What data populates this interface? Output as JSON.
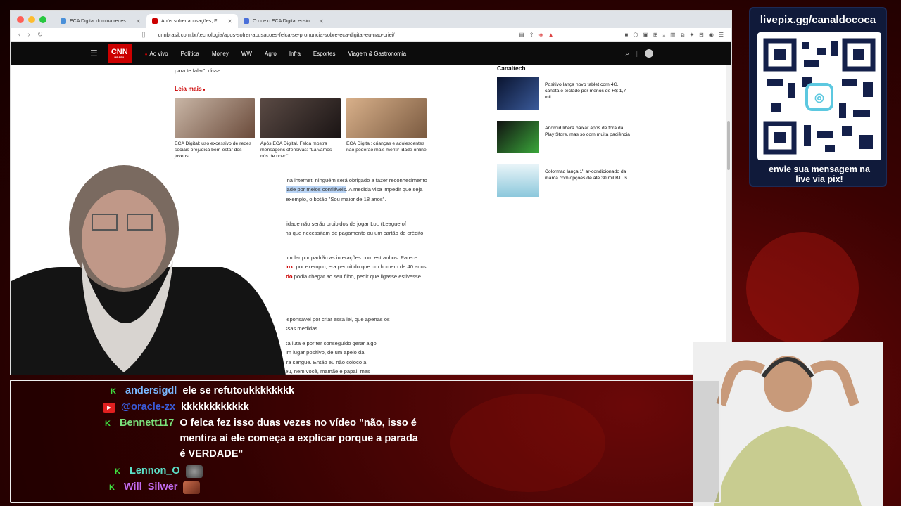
{
  "browser": {
    "tabs": [
      {
        "label": "ECA Digital domina redes e espõe",
        "active": false,
        "favicon_color": "#4a90d9"
      },
      {
        "label": "Após sofrer acusações, Felca",
        "active": true,
        "favicon_color": "#cc0000"
      },
      {
        "label": "O que o ECA Digital ensina sobre",
        "active": false,
        "favicon_color": "#4a6fd9"
      }
    ],
    "url": "cnnbrasil.com.br/tecnologia/apos-sofrer-acusacoes-felca-se-pronuncia-sobre-eca-digital-eu-nao-criei/"
  },
  "cnn": {
    "logo": "CNN",
    "logo_sub": "BRASIL",
    "menu": [
      "Ao vivo",
      "Política",
      "Money",
      "WW",
      "Agro",
      "Infra",
      "Esportes",
      "Viagem & Gastronomia"
    ]
  },
  "article": {
    "top_fragment": "para te falar\", disse.",
    "leia_mais": "Leia mais",
    "cards": [
      {
        "caption": "ECA Digital: uso excessivo de redes sociais prejudica bem-estar dos jovens",
        "color": "#7a5a48"
      },
      {
        "caption": "Após ECA Digital, Felca mostra mensagens ofensivas: \"Lá vamos nós de novo\"",
        "color": "#3a3030"
      },
      {
        "caption": "ECA Digital: crianças e adolescentes não poderão mais mentir idade online",
        "color": "#b88a60"
      }
    ],
    "p1_a": "Felca explicou que, ao contrário do que se fala na internet, ninguém será obrigado a fazer reconhecimento facial — e sim ",
    "p1_hl": "passar por uma verificação de idade por meios confiáveis",
    "p1_b": ". A medida visa impedir que seja feita a autodeclaração da faixa etária com, por exemplo, o botão \"Sou maior de 18 anos\".",
    "p2": "O influenciador ainda citou que os menores de idade não serão proibidos de jogar LoL (League of Legends), apenas não poderão brincar com itens que necessitam de pagamento ou um cartão de crédito.",
    "p3_a": "\"A lei também diz que os jogos vão precisar controlar por padrão as interações com estranhos. Parece meio exagerado até você lembrar que, no ",
    "p3_link1": "Roblox",
    "p3_b": ", por exemplo, era permitido que um homem de 40 anos conversasse com uma criança ",
    "p3_link2": "mal-intencionado",
    "p3_c": " podia chegar ao seu filho, pedir que ligasse ",
    "p3_d": "estivesse sem roupas. Parece terrível, mas era uma",
    "p4_a": "não foi responsável por criar essa lei, que apenas os",
    "p4_b": "lação dessas medidas.",
    "p5_a": "pela nossa luta e por ter conseguido gerar algo",
    "p5_b": "uem de um lugar positivo, de um apelo da",
    "p5_c": "a mão, vira sangue. Então eu não coloco a",
    "p5_d": "não sou eu, nem você, mamãe e papai, mas"
  },
  "sidebar": {
    "title": "Canaltech",
    "items": [
      {
        "caption": "Positivo lança novo tablet com 4G, caneta e teclado por menos de R$ 1,7 mil",
        "color": "#1a2a4a"
      },
      {
        "caption": "Android libera baixar apps de fora da Play Store, mas só com muita paciência",
        "color": "#2a8a2a"
      },
      {
        "caption": "Colormaq lança 1º ar-condicionado da marca com opções de até 30 mil BTUs",
        "color": "#9fd0e0"
      }
    ]
  },
  "qr": {
    "title": "livepix.gg/canaldococa",
    "caption_line1": "envie sua mensagem na",
    "caption_line2": "live via pix!"
  },
  "chat": {
    "messages": [
      {
        "platform": "kick",
        "user": "andersigdl",
        "user_color": "#7ab8ff",
        "message": "ele se refutoukkkkkkkk"
      },
      {
        "platform": "youtube",
        "user": "@oracle-zx",
        "user_color": "#3a5bd9",
        "message": "kkkkkkkkkkkk"
      },
      {
        "platform": "kick",
        "user": "Bennett117",
        "user_color": "#7ae07a",
        "message": "O felca fez isso duas vezes no vídeo \"não, isso é mentira aí ele começa a explicar porque a parada é VERDADE\""
      },
      {
        "platform": "kick",
        "user": "Lennon_O",
        "user_color": "#5ce0c8",
        "message": ""
      },
      {
        "platform": "kick",
        "user": "Will_Silwer",
        "user_color": "#c46cf0",
        "message": ""
      }
    ]
  },
  "colors": {
    "cnn_red": "#cc0000",
    "kick_green": "#3fe03f",
    "highlight": "#b9d4f5"
  }
}
